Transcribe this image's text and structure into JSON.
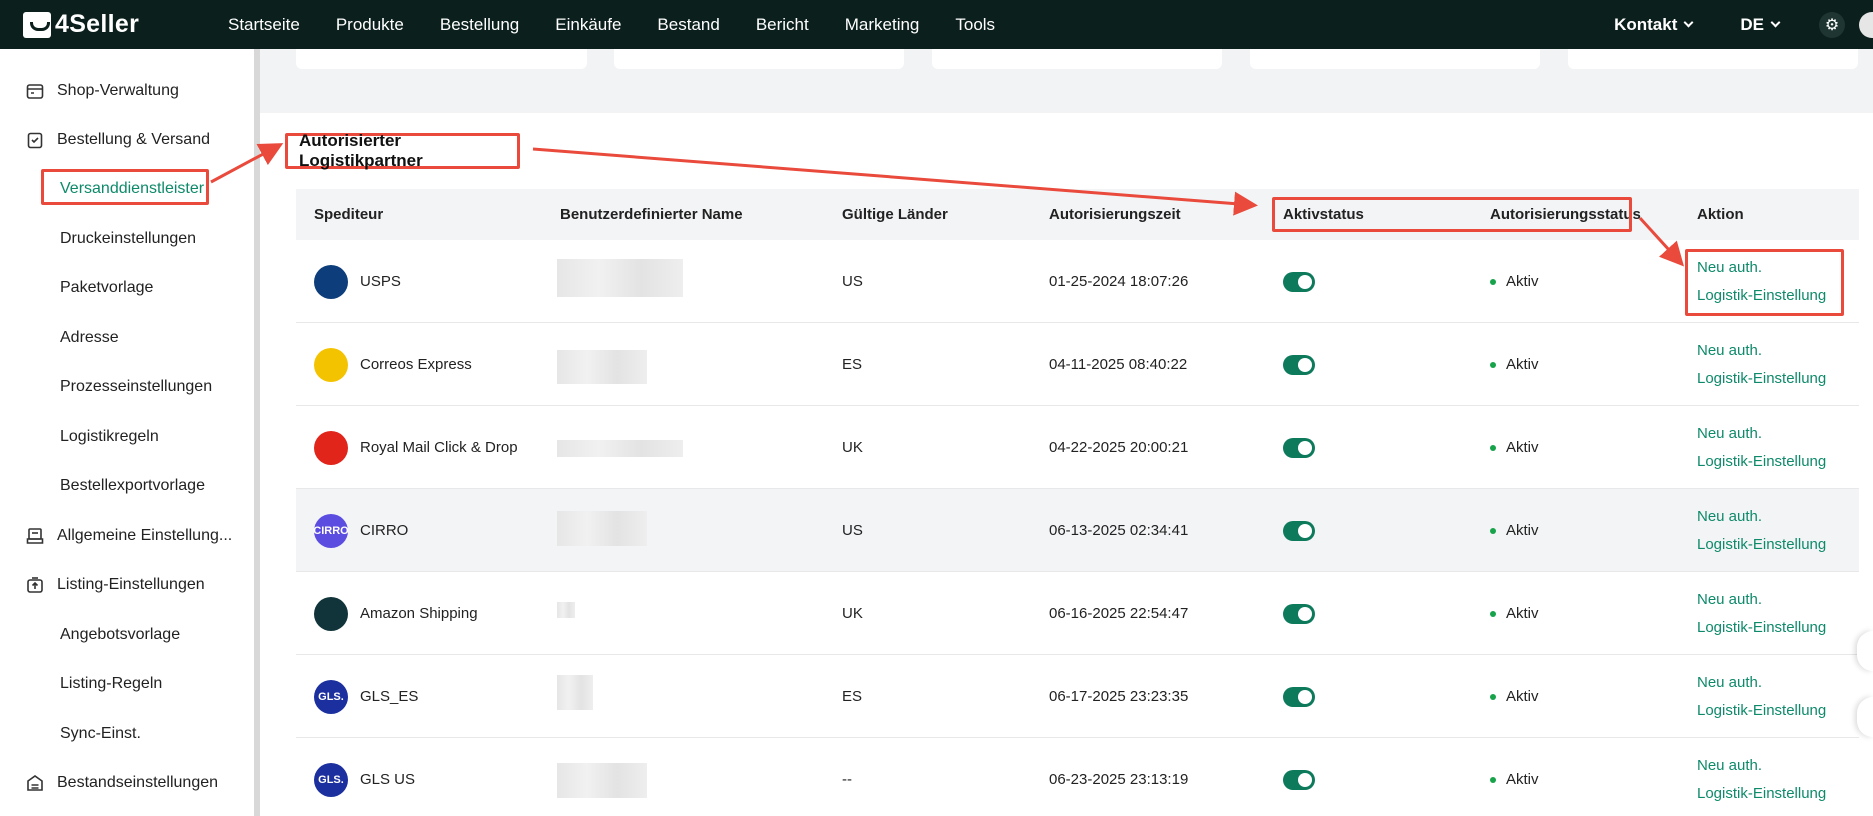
{
  "app": {
    "logo_text": "4Seller"
  },
  "nav": {
    "items": [
      "Startseite",
      "Produkte",
      "Bestellung",
      "Einkäufe",
      "Bestand",
      "Bericht",
      "Marketing",
      "Tools"
    ],
    "contact": "Kontakt",
    "language": "DE"
  },
  "sidebar": {
    "shop": "Shop-Verwaltung",
    "order": "Bestellung & Versand",
    "order_subs": [
      "Versanddienstleister",
      "Druckeinstellungen",
      "Paketvorlage",
      "Adresse",
      "Prozesseinstellungen",
      "Logistikregeln",
      "Bestellexportvorlage"
    ],
    "general": "Allgemeine Einstellung...",
    "listing": "Listing-Einstellungen",
    "listing_subs": [
      "Angebotsvorlage",
      "Listing-Regeln",
      "Sync-Einst."
    ],
    "stock": "Bestandseinstellungen"
  },
  "section": {
    "title": "Autorisierter Logistikpartner"
  },
  "table": {
    "headers": {
      "carrier": "Spediteur",
      "custom_name": "Benutzerdefinierter Name",
      "countries": "Gültige Länder",
      "auth_time": "Autorisierungszeit",
      "active": "Aktivstatus",
      "auth_status": "Autorisierungsstatus",
      "action": "Aktion"
    },
    "rows": [
      {
        "carrier": "USPS",
        "country": "US",
        "time": "01-25-2024 18:07:26",
        "status": "Aktiv",
        "logo_text": "",
        "logo_color": "#0d3d7a"
      },
      {
        "carrier": "Correos Express",
        "country": "ES",
        "time": "04-11-2025 08:40:22",
        "status": "Aktiv",
        "logo_text": "",
        "logo_color": "#f4c300"
      },
      {
        "carrier": "Royal Mail Click & Drop",
        "country": "UK",
        "time": "04-22-2025 20:00:21",
        "status": "Aktiv",
        "logo_text": "",
        "logo_color": "#e1251b"
      },
      {
        "carrier": "CIRRO",
        "country": "US",
        "time": "06-13-2025 02:34:41",
        "status": "Aktiv",
        "logo_text": "CIRRO",
        "logo_color": "#5b4de0"
      },
      {
        "carrier": "Amazon Shipping",
        "country": "UK",
        "time": "06-16-2025 22:54:47",
        "status": "Aktiv",
        "logo_text": "",
        "logo_color": "#10343a"
      },
      {
        "carrier": "GLS_ES",
        "country": "ES",
        "time": "06-17-2025 23:23:35",
        "status": "Aktiv",
        "logo_text": "GLS.",
        "logo_color": "#1b2f9e"
      },
      {
        "carrier": "GLS US",
        "country": "--",
        "time": "06-23-2025 23:13:19",
        "status": "Aktiv",
        "logo_text": "GLS.",
        "logo_color": "#1b2f9e"
      }
    ],
    "action_reauth": "Neu auth.",
    "action_settings": "Logistik-Einstellung"
  },
  "colors": {
    "accent": "#0e8a6a",
    "annotation": "#e94a3c",
    "topbar": "#0b1f1c"
  }
}
